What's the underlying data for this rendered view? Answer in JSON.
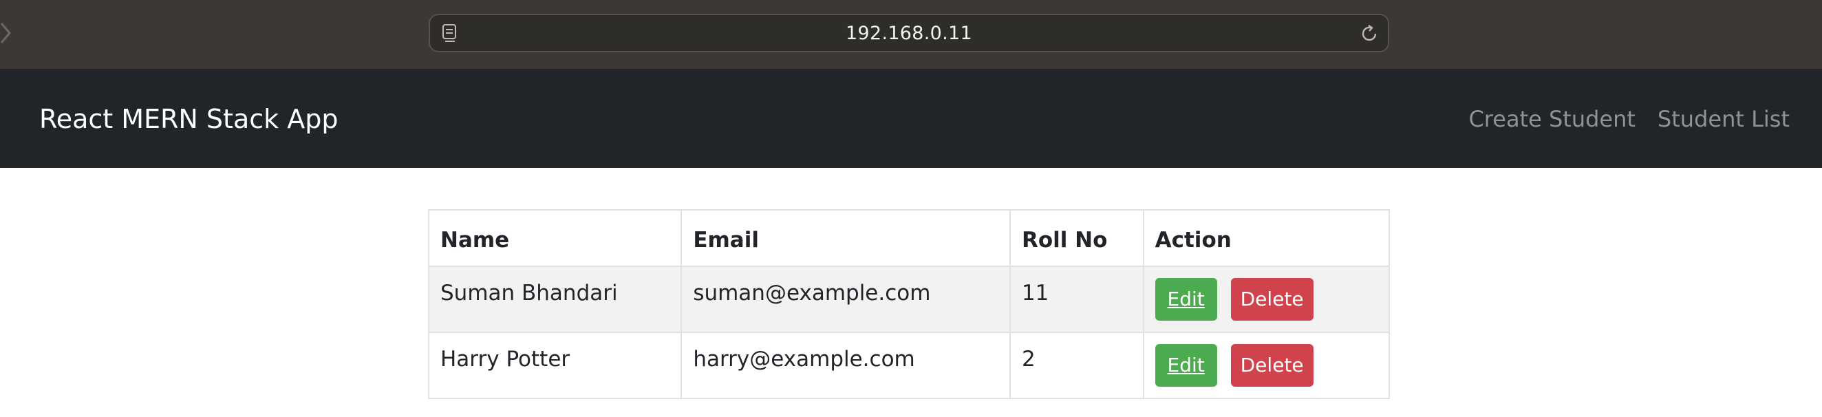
{
  "browser": {
    "url": "192.168.0.11"
  },
  "navbar": {
    "brand": "React MERN Stack App",
    "links": [
      {
        "label": "Create Student"
      },
      {
        "label": "Student List"
      }
    ]
  },
  "table": {
    "headers": [
      "Name",
      "Email",
      "Roll No",
      "Action"
    ],
    "rows": [
      {
        "name": "Suman Bhandari",
        "email": "suman@example.com",
        "roll_no": "11",
        "edit_label": "Edit",
        "delete_label": "Delete"
      },
      {
        "name": "Harry Potter",
        "email": "harry@example.com",
        "roll_no": "2",
        "edit_label": "Edit",
        "delete_label": "Delete"
      }
    ]
  },
  "colors": {
    "navbar_bg": "#212529",
    "edit_button": "#4caa50",
    "delete_button": "#d1434c",
    "striped_row": "#f2f2f2"
  },
  "icons": {
    "back": "chevron-left-icon",
    "page": "page-icon",
    "reload": "reload-icon"
  }
}
